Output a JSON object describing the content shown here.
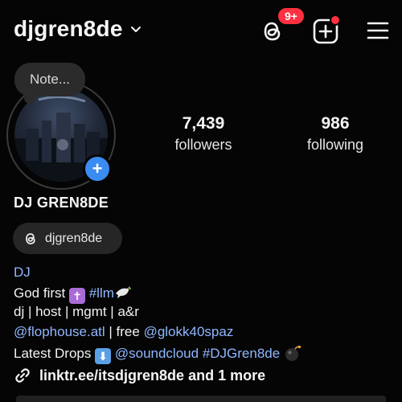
{
  "header": {
    "username": "djgren8de",
    "notification_badge": "9+",
    "icons": [
      "threads-icon",
      "add-post-icon",
      "menu-icon"
    ]
  },
  "profile": {
    "note": "Note...",
    "display_name": "DJ GREN8DE",
    "threads_handle": "djgren8de",
    "stats": {
      "followers_count": "7,439",
      "followers_label": "followers",
      "following_count": "986",
      "following_label": "following"
    }
  },
  "bio": {
    "category": "DJ",
    "line1_text": "God first",
    "line1_tag": "#llm",
    "line2": "dj | host | mgmt | a&r",
    "line3_mention1": "@flophouse.atl",
    "line3_mid": " | free ",
    "line3_mention2": "@glokk40spaz",
    "line4_text": "Latest Drops",
    "line4_mention": "@soundcloud",
    "line4_tag": "#DJGren8de",
    "link": "linktr.ee/itsdjgren8de and 1 more"
  },
  "colors": {
    "background": "#050505",
    "link_blue": "#8fb7ff",
    "badge_red": "#ff3040",
    "story_add_blue": "#3b8cf2"
  }
}
